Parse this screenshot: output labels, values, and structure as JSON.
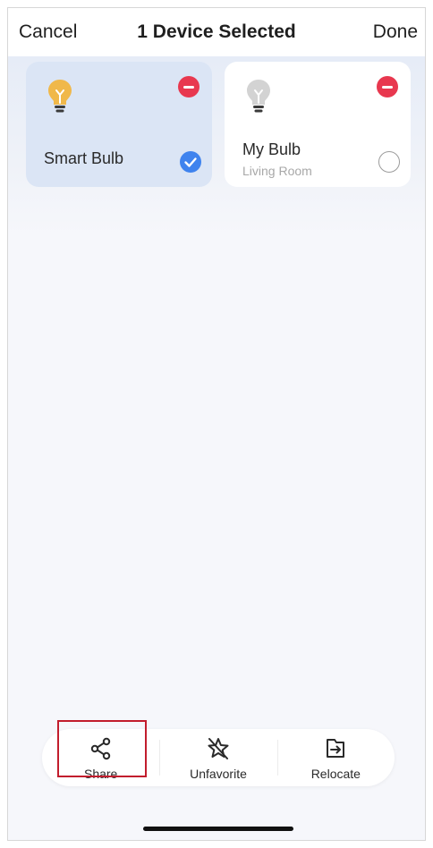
{
  "header": {
    "cancel_label": "Cancel",
    "title": "1 Device Selected",
    "done_label": "Done"
  },
  "devices": [
    {
      "name": "Smart Bulb",
      "room": "",
      "selected": true,
      "icon": "lightbulb-icon",
      "icon_color": "#f0b84a"
    },
    {
      "name": "My Bulb",
      "room": "Living Room",
      "selected": false,
      "icon": "lightbulb-icon",
      "icon_color": "#d3d3d3"
    }
  ],
  "actions": [
    {
      "label": "Share",
      "icon": "share-icon",
      "highlighted": true
    },
    {
      "label": "Unfavorite",
      "icon": "unfavorite-star-icon",
      "highlighted": false
    },
    {
      "label": "Relocate",
      "icon": "relocate-icon",
      "highlighted": false
    }
  ],
  "colors": {
    "accent": "#3f83ee",
    "remove": "#e8384f",
    "highlight_border": "#c21d2d",
    "selected_card": "#dbe5f5"
  }
}
